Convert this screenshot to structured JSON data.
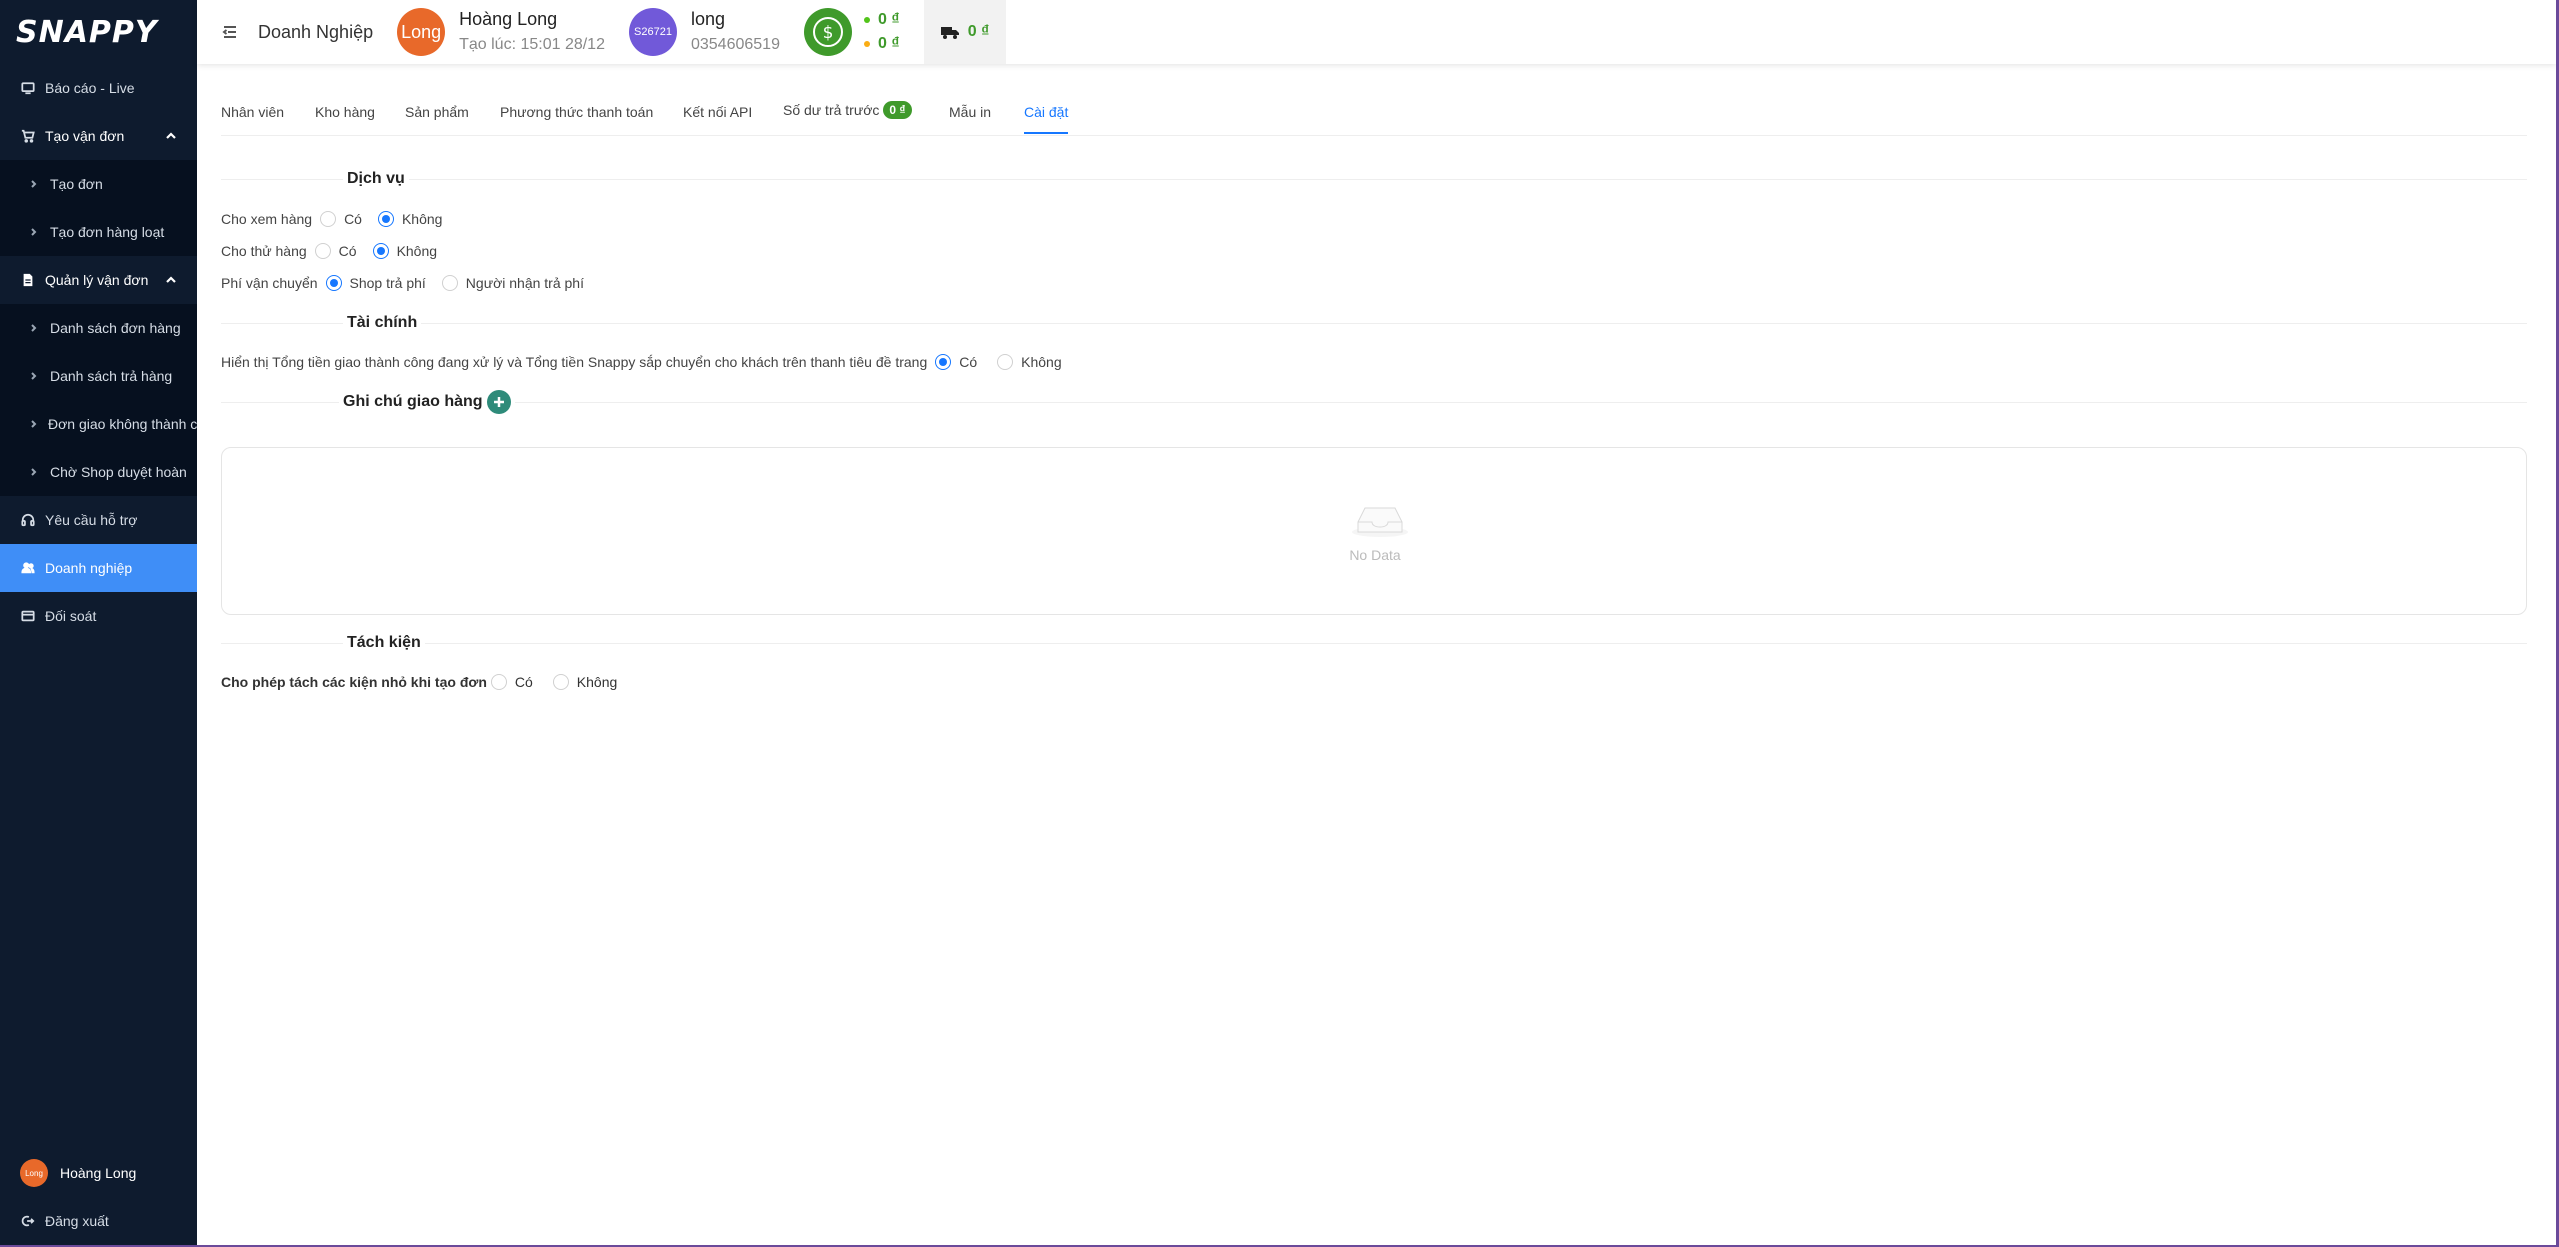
{
  "brand": {
    "logo": "SNAPPY"
  },
  "sidebar": {
    "items": [
      {
        "label": "Báo cáo - Live"
      },
      {
        "label": "Tạo vận đơn",
        "sub": [
          "Tạo đơn",
          "Tạo đơn hàng loạt"
        ]
      },
      {
        "label": "Quản lý vận đơn",
        "sub": [
          "Danh sách đơn hàng",
          "Danh sách trả hàng",
          "Đơn giao không thành công",
          "Chờ Shop duyệt hoàn"
        ]
      },
      {
        "label": "Yêu cầu hỗ trợ"
      },
      {
        "label": "Doanh nghiệp"
      },
      {
        "label": "Đối soát"
      }
    ],
    "user": {
      "avatar_text": "Long",
      "name": "Hoàng Long"
    },
    "logout_label": "Đăng xuất"
  },
  "header": {
    "title": "Doanh Nghiệp",
    "owner": {
      "avatar_text": "Long",
      "name": "Hoàng Long",
      "created": "Tạo lúc: 15:01 28/12"
    },
    "account": {
      "avatar_text": "S26721",
      "name": "long",
      "phone": "0354606519"
    },
    "balance_main": "0 ₫",
    "balance_pending": "0 ₫",
    "cod_balance": "0 ₫",
    "colors": {
      "green": "#3f9a2b",
      "orange": "#e8692a",
      "purple": "#7159d9",
      "accent": "#1677ff"
    }
  },
  "tabs": {
    "employees": "Nhân viên",
    "warehouse": "Kho hàng",
    "products": "Sản phẩm",
    "payment": "Phương thức thanh toán",
    "api": "Kết nối API",
    "prepaid": "Số dư trả trước",
    "prepaid_badge": "0 ₫",
    "print": "Mẫu in",
    "settings": "Cài đặt"
  },
  "services": {
    "title": "Dịch vụ",
    "view_goods": {
      "label": "Cho xem hàng",
      "yes": "Có",
      "no": "Không",
      "selected": "no"
    },
    "try_goods": {
      "label": "Cho thử hàng",
      "yes": "Có",
      "no": "Không",
      "selected": "no"
    },
    "shipping_fee": {
      "label": "Phí vận chuyển",
      "shop": "Shop trả phí",
      "receiver": "Người nhận trả phí",
      "selected": "shop"
    }
  },
  "finance": {
    "title": "Tài chính",
    "display": {
      "label": "Hiển thị Tổng tiền giao thành công đang xử lý và Tổng tiền Snappy sắp chuyển cho khách trên thanh tiêu đề trang",
      "yes": "Có",
      "no": "Không",
      "selected": "yes"
    }
  },
  "notes": {
    "title": "Ghi chú giao hàng",
    "empty": "No Data"
  },
  "split": {
    "title": "Tách kiện",
    "allow": {
      "label": "Cho phép tách các kiện nhỏ khi tạo đơn",
      "yes": "Có",
      "no": "Không",
      "selected": "none"
    }
  }
}
